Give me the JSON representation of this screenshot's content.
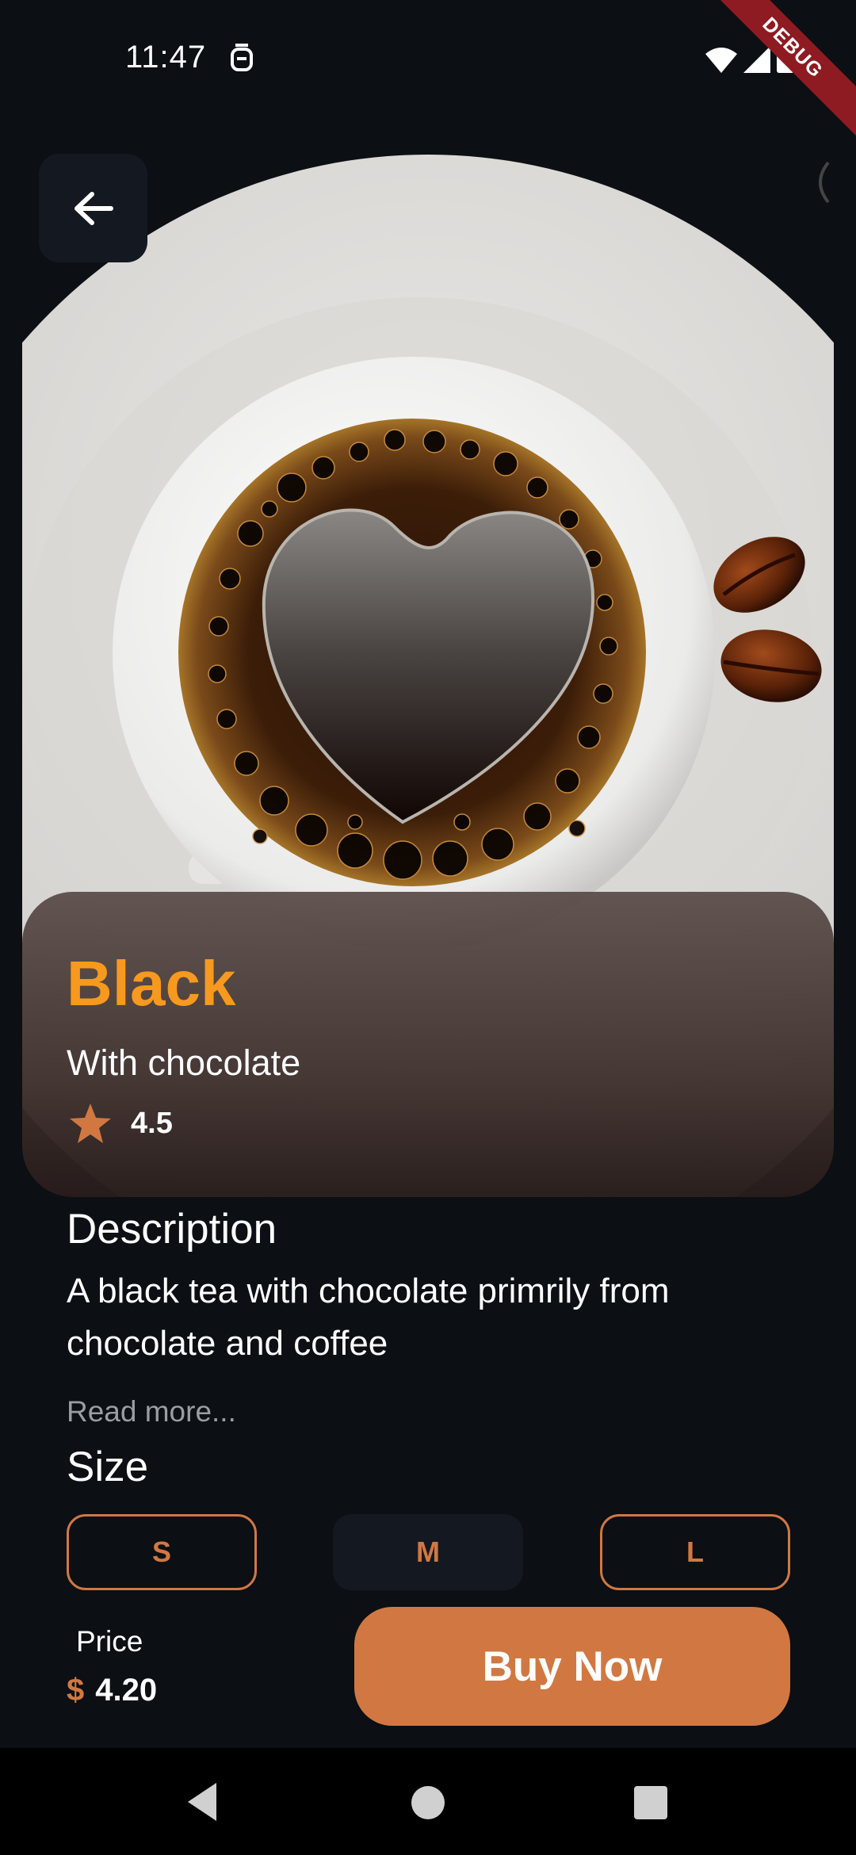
{
  "status_bar": {
    "time": "11:47",
    "debug_label": "DEBUG",
    "icons": [
      "alarm-icon",
      "wifi-icon",
      "signal-icon",
      "battery-icon"
    ]
  },
  "header": {
    "back_icon": "arrow-left-icon"
  },
  "product": {
    "name": "Black",
    "subtitle": "With chocolate",
    "rating": "4.5",
    "image": "coffee-cup-heart-image"
  },
  "description": {
    "title": "Description",
    "text": "A black tea with chocolate primrily from chocolate and coffee",
    "read_more": "Read more..."
  },
  "size": {
    "title": "Size",
    "options": [
      "S",
      "M",
      "L"
    ],
    "selected": "M"
  },
  "price": {
    "label": "Price",
    "currency": "$",
    "amount": "4.20"
  },
  "actions": {
    "buy_label": "Buy Now"
  },
  "colors": {
    "background": "#0c0f14",
    "accent": "#d17842",
    "name": "#f7991e",
    "card": "#141921"
  }
}
